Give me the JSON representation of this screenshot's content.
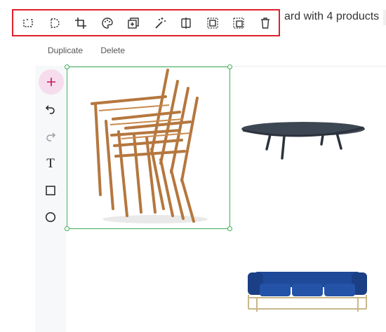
{
  "toolbar": {
    "tools": [
      {
        "name": "select-frame-icon"
      },
      {
        "name": "select-shape-icon"
      },
      {
        "name": "crop-icon"
      },
      {
        "name": "palette-icon"
      },
      {
        "name": "layer-add-icon"
      },
      {
        "name": "magic-wand-icon"
      },
      {
        "name": "flip-icon"
      },
      {
        "name": "bring-front-icon"
      },
      {
        "name": "send-back-icon"
      },
      {
        "name": "trash-icon"
      }
    ]
  },
  "header": {
    "title_fragment": "ard with 4 products"
  },
  "actions": {
    "duplicate": "Duplicate",
    "delete": "Delete"
  },
  "sidebar": {
    "items": [
      {
        "name": "add-icon"
      },
      {
        "name": "undo-icon"
      },
      {
        "name": "redo-icon"
      },
      {
        "name": "text-tool-icon",
        "label": "T"
      },
      {
        "name": "rectangle-tool-icon"
      },
      {
        "name": "circle-tool-icon"
      }
    ]
  },
  "canvas": {
    "items": [
      {
        "name": "stacked-chairs-image",
        "selected": true
      },
      {
        "name": "coffee-table-image"
      },
      {
        "name": "blue-sofa-image"
      }
    ]
  },
  "colors": {
    "highlight_border": "#e0202a",
    "selection": "#3fae5b",
    "add_button_bg": "#f6dcec",
    "add_icon": "#c2185b",
    "sofa_blue": "#1f4a99",
    "table_top": "#3d4754",
    "wood": "#b5773e"
  }
}
